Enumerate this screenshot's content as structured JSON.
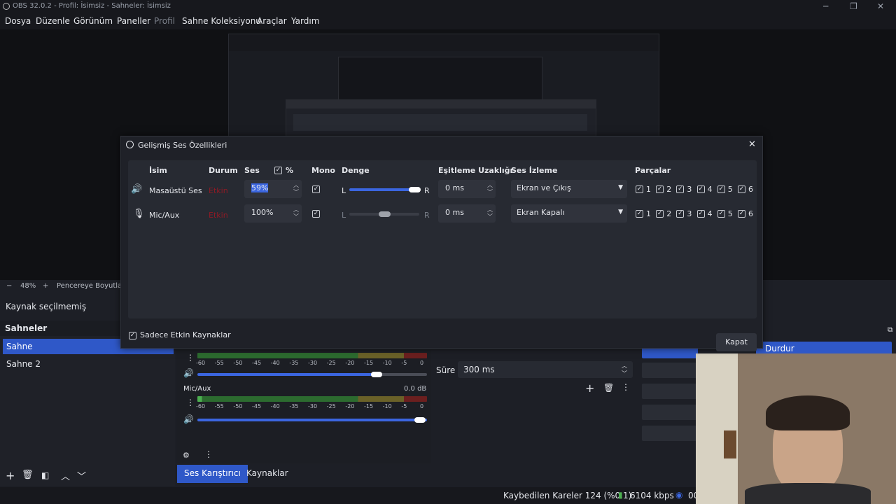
{
  "window": {
    "title": "OBS 32.0.2 - Profil: İsimsiz - Sahneler: İsimsiz",
    "minimize_icon": "minimize-icon",
    "maximize_icon": "maximize-icon",
    "close_icon": "close-icon"
  },
  "menu": [
    "Dosya",
    "Düzenle",
    "Görünüm",
    "Paneller",
    "Profil",
    "Sahne Koleksiyonu",
    "Araçlar",
    "Yardım"
  ],
  "preview": {
    "zoom": "48%",
    "zoom_minus": "−",
    "zoom_plus": "+",
    "fit_label": "Pencereye Boyutlandır"
  },
  "source_bar": {
    "label": "Kaynak seçilmemiş"
  },
  "scenes": {
    "title": "Sahneler",
    "items": [
      "Sahne",
      "Sahne 2"
    ]
  },
  "mixer": {
    "scale": [
      "-60",
      "-55",
      "-50",
      "-45",
      "-40",
      "-35",
      "-30",
      "-25",
      "-20",
      "-15",
      "-10",
      "-5",
      "0"
    ],
    "channels": [
      {
        "name": "Mic/Aux",
        "db": "0.0 dB"
      }
    ]
  },
  "tabs": {
    "mixer": "Ses Karıştırıcı",
    "sources": "Kaynaklar"
  },
  "transition": {
    "duration_label": "Süre",
    "duration_value": "300 ms"
  },
  "controls": {
    "stop_label": "Durdur"
  },
  "status": {
    "dropped": "Kaybedilen Kareler 124 (%0.1)",
    "bitrate": "6104 kbps",
    "rec_prefix": "00"
  },
  "dialog": {
    "title": "Gelişmiş Ses Özellikleri",
    "headers": {
      "name": "İsim",
      "status": "Durum",
      "volume": "Ses",
      "percent": "%",
      "mono": "Mono",
      "balance": "Denge",
      "sync": "Eşitleme Uzaklığı",
      "monitor": "Ses İzleme",
      "tracks": "Parçalar"
    },
    "rows": [
      {
        "name": "Masaüstü Ses",
        "status": "Etkin",
        "volume": "59%",
        "mono": true,
        "balance_left": "L",
        "balance_right": "R",
        "balance": 1.0,
        "sync": "0 ms",
        "monitor": "Ekran ve Çıkış",
        "tracks": [
          "1",
          "2",
          "3",
          "4",
          "5",
          "6"
        ]
      },
      {
        "name": "Mic/Aux",
        "status": "Etkin",
        "volume": "100%",
        "mono": true,
        "balance_left": "L",
        "balance_right": "R",
        "balance": 0.5,
        "sync": "0 ms",
        "monitor": "Ekran Kapalı",
        "tracks": [
          "1",
          "2",
          "3",
          "4",
          "5",
          "6"
        ]
      }
    ],
    "only_active_label": "Sadece Etkin Kaynaklar",
    "close_label": "Kapat"
  },
  "colors": {
    "accent": "#2f58c8",
    "status_red": "#8e1a25",
    "meter_green": "#4caf50",
    "meter_yellow": "#c8a82a",
    "meter_red": "#b52a2a"
  }
}
